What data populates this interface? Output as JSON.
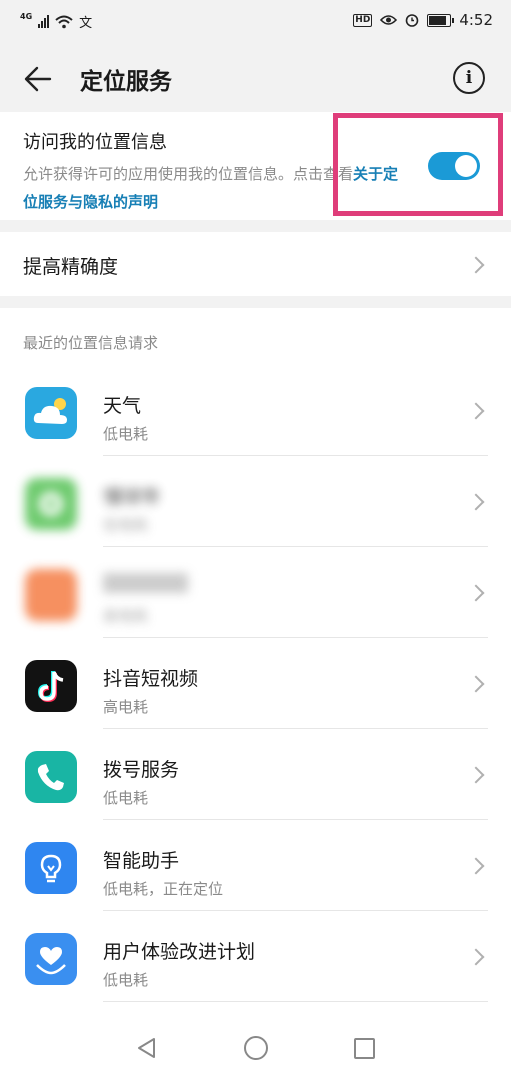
{
  "status_bar": {
    "network": "4G",
    "time": "4:52",
    "hd": "HD"
  },
  "header": {
    "title": "定位服务"
  },
  "location_access": {
    "title": "访问我的位置信息",
    "description_prefix": "允许获得许可的应用使用我的位置信息。点击查看",
    "link_text": "关于定位服务与隐私的声明",
    "enabled": true
  },
  "accuracy": {
    "label": "提高精确度"
  },
  "recent_requests": {
    "section_label": "最近的位置信息请求",
    "apps": [
      {
        "name": "天气",
        "usage": "低电耗",
        "icon": "weather-icon",
        "color": "#2aa8e0"
      },
      {
        "name": "懂球帝",
        "usage": "低电耗",
        "icon": "soccer-icon",
        "color": "#3db93d"
      },
      {
        "name": "",
        "usage": "高电耗",
        "icon": "app-icon",
        "color": "#f36b2b"
      },
      {
        "name": "抖音短视频",
        "usage": "高电耗",
        "icon": "douyin-icon",
        "color": "#121212"
      },
      {
        "name": "拨号服务",
        "usage": "低电耗",
        "icon": "phone-icon",
        "color": "#19b5a4"
      },
      {
        "name": "智能助手",
        "usage": "低电耗，正在定位",
        "icon": "bulb-icon",
        "color": "#2f86f0"
      },
      {
        "name": "用户体验改进计划",
        "usage": "低电耗",
        "icon": "heart-hand-icon",
        "color": "#3a8ff0"
      }
    ]
  },
  "nav_bar": {
    "back_icon": "triangle-back-icon",
    "home_icon": "circle-home-icon",
    "recent_icon": "square-recent-icon"
  }
}
